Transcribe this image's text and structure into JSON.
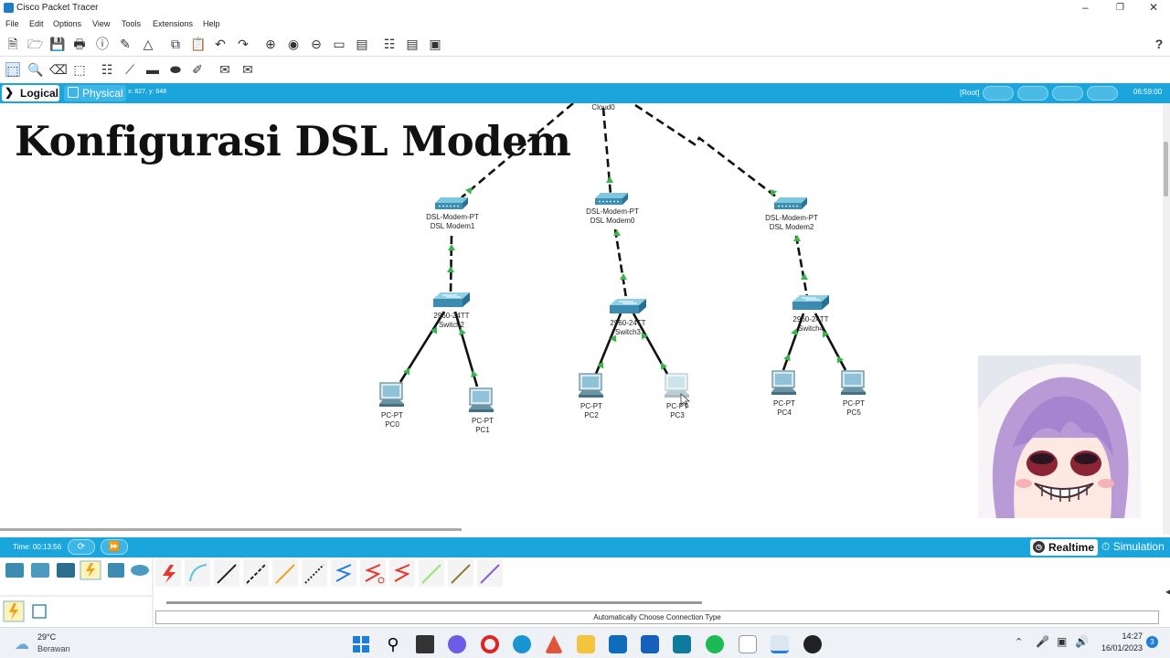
{
  "window": {
    "title": "Cisco Packet Tracer"
  },
  "menu": [
    "File",
    "Edit",
    "Options",
    "View",
    "Tools",
    "Extensions",
    "Help"
  ],
  "toolbar": {
    "help_glyph": "?"
  },
  "workspace_bar": {
    "logical_tab": "Logical",
    "physical_tab": "Physical",
    "coords": "x: 827, y: 648",
    "root_label": "[Root]",
    "clock": "06:59:00"
  },
  "overlay_title": "Konfigurasi DSL Modem",
  "topology": {
    "cloud": {
      "name": "Cloud0"
    },
    "modems": [
      {
        "model": "DSL-Modem-PT",
        "name": "DSL Modem1"
      },
      {
        "model": "DSL-Modem-PT",
        "name": "DSL Modem0"
      },
      {
        "model": "DSL-Modem-PT",
        "name": "DSL Modem2"
      }
    ],
    "switches": [
      {
        "model": "2960-24TT",
        "name": "Switch2"
      },
      {
        "model": "2960-24TT",
        "name": "Switch3"
      },
      {
        "model": "2960-24TT",
        "name": "Switch4"
      }
    ],
    "pcs": [
      {
        "model": "PC-PT",
        "name": "PC0"
      },
      {
        "model": "PC-PT",
        "name": "PC1"
      },
      {
        "model": "PC-PT",
        "name": "PC2"
      },
      {
        "model": "PC-PT",
        "name": "PC3"
      },
      {
        "model": "PC-PT",
        "name": "PC4"
      },
      {
        "model": "PC-PT",
        "name": "PC5"
      }
    ]
  },
  "simbar": {
    "time": "Time: 00:13:56",
    "realtime_label": "Realtime",
    "simulation_label": "Simulation"
  },
  "device_panel": {
    "connection_hint": "Automatically Choose Connection Type"
  },
  "taskbar": {
    "weather_temp": "29°C",
    "weather_desc": "Berawan",
    "time": "14:27",
    "date": "16/01/2023"
  },
  "colors": {
    "accent": "#1aa5dd",
    "link_arrow": "#39b54a"
  }
}
